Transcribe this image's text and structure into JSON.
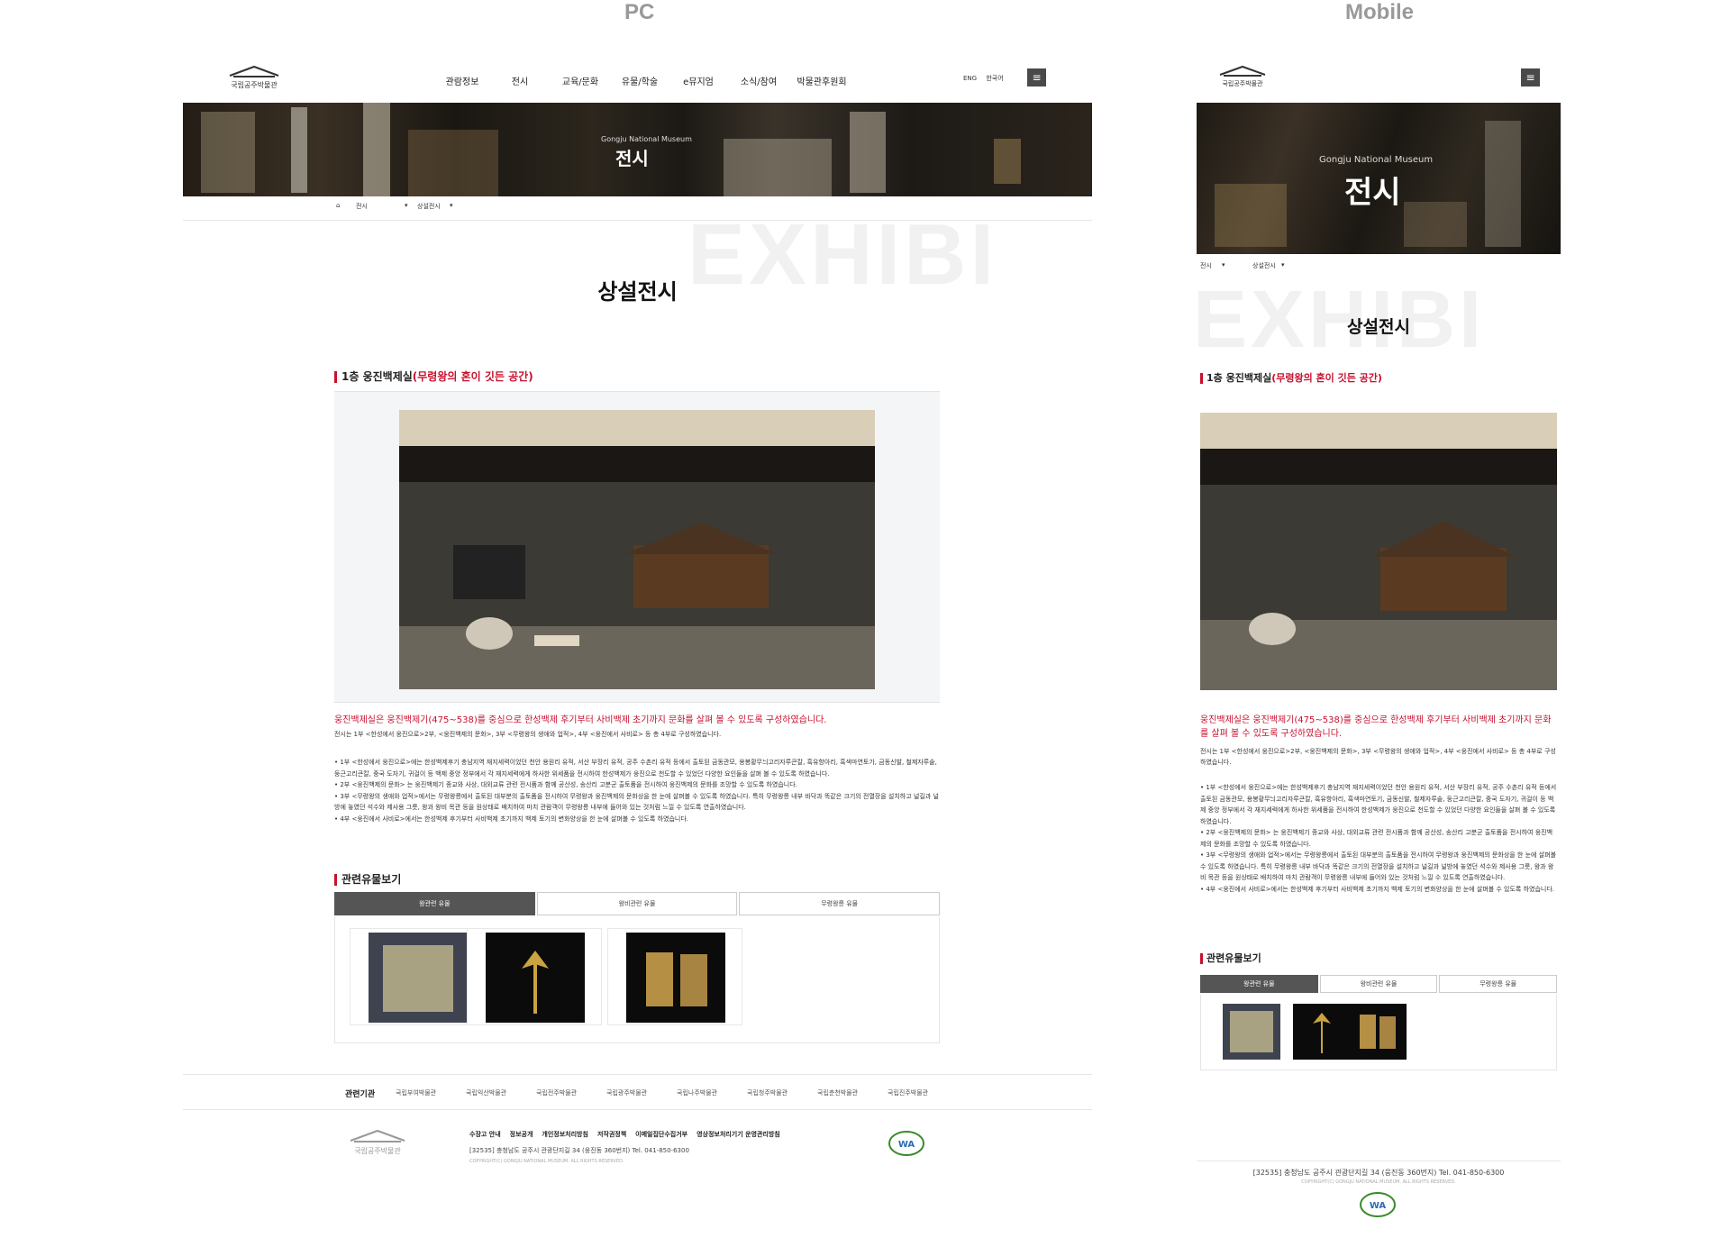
{
  "labels": {
    "pc": "PC",
    "mobile": "Mobile"
  },
  "header": {
    "logo_text": "국립공주박물관",
    "nav": [
      "관람정보",
      "전시",
      "교육/문화",
      "유물/학술",
      "e뮤지엄",
      "소식/참여",
      "박물관후원회"
    ],
    "lang": [
      "ENG",
      "한국어"
    ],
    "menu_icon": "hamburger-icon"
  },
  "banner": {
    "subtitle": "Gongju National Museum",
    "title": "전시"
  },
  "breadcrumb": {
    "home_icon": "home-icon",
    "level1": "전시",
    "level2": "상설전시"
  },
  "watermark": "EXHIBI",
  "page_title": "상설전시",
  "section": {
    "title_main": "1층 웅진백제실",
    "title_highlight": "(무령왕의 혼이 깃든 공간)",
    "intro_red": "웅진백제실은 웅진백제기(475~538)를 중심으로 한성백제 후기부터 사비백제 초기까지 문화를 살펴 볼 수 있도록 구성하였습니다.",
    "intro": "전시는 1부 <한성에서 웅진으로>2부, <웅진백제의 문화>, 3부 <무령왕의 생애와 업적>, 4부 <웅진에서 사비로> 등 총 4부로 구성하였습니다.",
    "bullets": [
      "• 1부 <한성에서 웅진으로>에는 한성백제후기 충남지역 재지세력이었던 천안 용원리 유적, 서산 부장리 유적, 공주 수촌리 유적 등에서 출토된 금동관모, 용봉황무늬고리자루큰칼, 흑유항아리, 흑색마연토기, 금동신발, 철제자루솥, 둥근고리큰칼, 중국 도자기, 귀걸이 등 백제 중앙 정부에서 각 재지세력에게 하사한 위세품을 전시하여 한성백제가 웅진으로 천도할 수 있었던 다양한 요인들을 살펴 볼 수 있도록 하였습니다.",
      "• 2부 <웅진백제의 문화> 는 웅진백제기 종교와 사상, 대외교류 관련 전시품과 함께 공산성, 송산리 고분군 출토품을 전시하여 웅진백제의 문화를 조망할 수 있도록 하였습니다.",
      "• 3부 <무령왕의 생애와 업적>에서는 무령왕릉에서 출토된 대부분의 출토품을 전시하여 무령왕과 웅진백제의 문화상을 한 눈에 살펴볼 수 있도록 하였습니다. 특히 무령왕릉 내부 바닥과 똑같은 크기의 전열장을 설치하고 널길과 널방에 놓였던 석수와 제사용 그릇, 왕과 왕비 목관 등을 원상태로 배치하여 마치 관람객이 무령왕릉 내부에 들어와 있는 것처럼 느낄 수 있도록 연출하였습니다.",
      "• 4부 <웅진에서 사비로>에서는 한성백제 후기부터 사비백제 초기까지 백제 토기의 변화양상을 한 눈에 살펴볼 수 있도록 하였습니다."
    ]
  },
  "related": {
    "title": "관련유물보기",
    "tabs": [
      "왕관련 유물",
      "왕비관련 유물",
      "무령왕릉 유물"
    ]
  },
  "footer": {
    "related_label": "관련기관",
    "related_links": [
      "국립부여박물관",
      "국립익산박물관",
      "국립전주박물관",
      "국립광주박물관",
      "국립나주박물관",
      "국립청주박물관",
      "국립춘천박물관",
      "국립진주박물관"
    ],
    "links": [
      "수장고 안내",
      "정보공개",
      "개인정보처리방침",
      "저작권정책",
      "이메일집단수집거부",
      "영상정보처리기기 운영관리방침"
    ],
    "address": "[32535] 충청남도 공주시 관광단지길 34 (웅진동 360번지) Tel. 041-850-6300",
    "copyright": "COPYRIGHT(C) GONGJU NATIONAL MUSEUM. ALL RIGHTS RESERVED.",
    "wa_mark": "WA"
  }
}
